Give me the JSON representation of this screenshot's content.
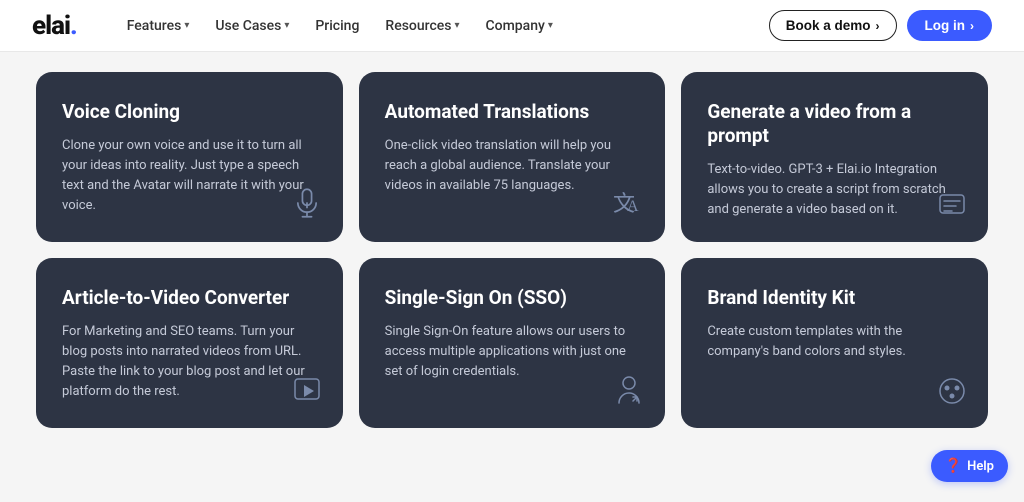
{
  "logo": {
    "text": "elai",
    "dot": "."
  },
  "nav": {
    "links": [
      {
        "label": "Features",
        "has_dropdown": true
      },
      {
        "label": "Use Cases",
        "has_dropdown": true
      },
      {
        "label": "Pricing",
        "has_dropdown": false
      },
      {
        "label": "Resources",
        "has_dropdown": true
      },
      {
        "label": "Company",
        "has_dropdown": true
      }
    ],
    "book_demo_label": "Book a demo",
    "login_label": "Log in"
  },
  "cards": [
    {
      "id": "voice-cloning",
      "title": "Voice Cloning",
      "desc": "Clone your own voice and use it to turn all your ideas into reality. Just type a speech text and the Avatar will narrate it with your voice.",
      "icon": "🎙"
    },
    {
      "id": "automated-translations",
      "title": "Automated Translations",
      "desc": "One-click video translation will help you reach a global audience. Translate your videos in available 75 languages.",
      "icon": "译"
    },
    {
      "id": "generate-video-prompt",
      "title": "Generate a video from a prompt",
      "desc": "Text-to-video. GPT-3 + Elai.io Integration allows you to create a script from scratch and generate a video based on it.",
      "icon": "▤"
    },
    {
      "id": "article-to-video",
      "title": "Article-to-Video Converter",
      "desc": "For Marketing and SEO teams. Turn your blog posts into narrated videos from URL. Paste the link to your blog post and let our platform do the rest.",
      "icon": "▶"
    },
    {
      "id": "sso",
      "title": "Single-Sign On (SSO)",
      "desc": "Single Sign-On feature allows our users to access multiple applications with just one set of login credentials.",
      "icon": "👤"
    },
    {
      "id": "brand-identity",
      "title": "Brand Identity Kit",
      "desc": "Create custom templates with the company's band colors and styles.",
      "icon": "🎨"
    }
  ],
  "help": {
    "label": "Help"
  }
}
